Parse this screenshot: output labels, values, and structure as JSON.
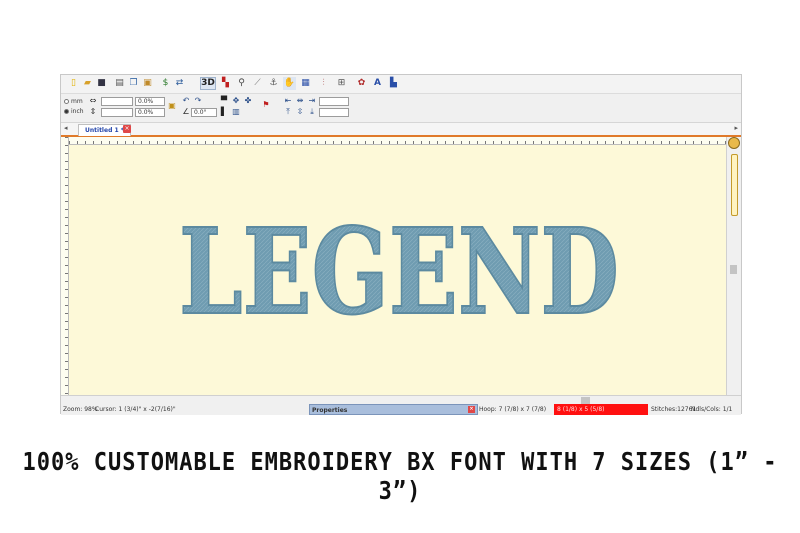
{
  "toolbar": {
    "icons": [
      "new-file-icon",
      "open-folder-icon",
      "save-icon",
      "print-icon",
      "copy-icon",
      "paste-icon",
      "dollar-icon",
      "convert-icon",
      "3d-icon",
      "color-icon",
      "magnify-icon",
      "ruler-icon",
      "stitch-icon",
      "hand-icon",
      "hoop-icon",
      "needle-icon",
      "grid-icon",
      "palette-icon",
      "letter-a-icon",
      "export-icon"
    ],
    "three_d_label": "3D"
  },
  "properties_bar": {
    "unit_mm": "mm",
    "unit_inch": "inch",
    "width_value": "",
    "width_percent": "0.0%",
    "height_value": "",
    "height_percent": "0.0%",
    "angle_value": "0.0°"
  },
  "tabs": [
    {
      "label": "Untitled 1 *"
    }
  ],
  "design": {
    "text": "LEGEND",
    "fill_color": "#6f9cb1",
    "stroke_color": "#5c8aa0"
  },
  "status": {
    "zoom": "Zoom: 98%",
    "cursor": "Cursor: 1 (3/4)\" x -2(7/16)\"",
    "properties_label": "Properties",
    "hoop": "Hoop: 7 (7/8) x 7 (7/8)",
    "size": "8 (1/8) x 5 (5/8)",
    "stitches": "Stitches:12761",
    "ndls": "Ndls/Cols: 1/1"
  },
  "caption": "100% CUSTOMABLE EMBROIDERY BX FONT WITH 7 SIZES (1” -  3”)"
}
